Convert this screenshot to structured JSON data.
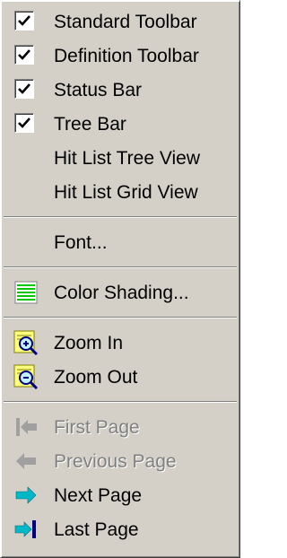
{
  "menu": {
    "items": [
      {
        "label": "Standard Toolbar",
        "checked": true
      },
      {
        "label": "Definition Toolbar",
        "checked": true
      },
      {
        "label": "Status Bar",
        "checked": true
      },
      {
        "label": "Tree Bar",
        "checked": true
      },
      {
        "label": "Hit List Tree View",
        "checked": false
      },
      {
        "label": "Hit List Grid View",
        "checked": false
      },
      {
        "label": "Font...",
        "icon": "none"
      },
      {
        "label": "Color Shading...",
        "icon": "color-shading-icon"
      },
      {
        "label": "Zoom In",
        "icon": "zoom-in-icon"
      },
      {
        "label": "Zoom Out",
        "icon": "zoom-out-icon"
      },
      {
        "label": "First Page",
        "icon": "first-page-icon",
        "enabled": false
      },
      {
        "label": "Previous Page",
        "icon": "previous-page-icon",
        "enabled": false
      },
      {
        "label": "Next Page",
        "icon": "next-page-icon",
        "enabled": true
      },
      {
        "label": "Last Page",
        "icon": "last-page-icon",
        "enabled": true
      }
    ]
  },
  "colors": {
    "menu_face": "#d4d0c8",
    "disabled_text": "#808080",
    "nav_arrow": "#00b8c8",
    "nav_bar": "#000080",
    "shading_green": "#00c800"
  }
}
